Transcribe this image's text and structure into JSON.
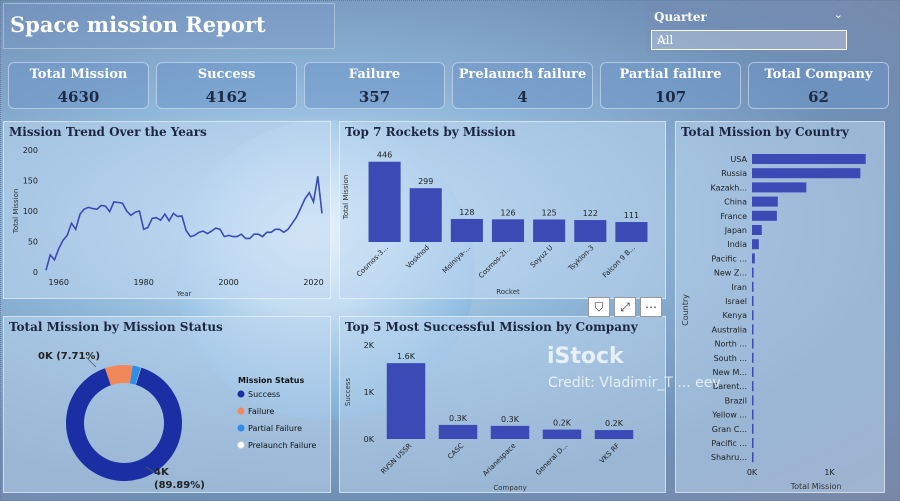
{
  "title": "Space mission Report",
  "slicer": {
    "label": "Quarter",
    "value": "All"
  },
  "kpis": [
    {
      "label": "Total Mission",
      "value": "4630"
    },
    {
      "label": "Success",
      "value": "4162"
    },
    {
      "label": "Failure",
      "value": "357"
    },
    {
      "label": "Prelaunch failure",
      "value": "4"
    },
    {
      "label": "Partial failure",
      "value": "107"
    },
    {
      "label": "Total Company",
      "value": "62"
    }
  ],
  "trend": {
    "title": "Mission Trend Over the Years",
    "xlabel": "Year",
    "ylabel": "Total Mission",
    "yticks": [
      "200",
      "150",
      "100",
      "50",
      "0"
    ],
    "xticks": [
      "1960",
      "1980",
      "2000",
      "2020"
    ]
  },
  "rockets": {
    "title": "Top 7 Rockets by Mission",
    "xlabel": "Rocket",
    "ylabel": "Total Mission"
  },
  "country": {
    "title": "Total Mission by Country",
    "xlabel": "Total Mission",
    "ylabel": "Country",
    "xticks": [
      "0K",
      "1K"
    ]
  },
  "status": {
    "title": "Total Mission by Mission Status",
    "legend_title": "Mission Status",
    "label_small": "0K (7.71%)",
    "label_big_1": "4K",
    "label_big_2": "(89.89%)"
  },
  "company": {
    "title": "Top 5 Most Successful Mission by Company",
    "xlabel": "Company",
    "ylabel": "Success",
    "yticks": [
      "2K",
      "1K",
      "0K"
    ]
  },
  "watermark": {
    "line1": "iStock",
    "line2": "Credit: Vladimir_T ... eev"
  },
  "colors": {
    "bar": "#3a4bb6",
    "line": "#3a4bb6",
    "success": "#1a2fa3",
    "failure": "#f0885a",
    "partial": "#2f8fe8",
    "prelaunch": "#ffffff"
  },
  "chart_data": [
    {
      "type": "line",
      "title": "Mission Trend Over the Years",
      "xlabel": "Year",
      "ylabel": "Total Mission",
      "xlim": [
        1957,
        2022
      ],
      "ylim": [
        0,
        200
      ],
      "x": [
        1957,
        1958,
        1959,
        1960,
        1961,
        1962,
        1963,
        1964,
        1965,
        1966,
        1967,
        1968,
        1969,
        1970,
        1971,
        1972,
        1973,
        1974,
        1975,
        1976,
        1977,
        1978,
        1979,
        1980,
        1981,
        1982,
        1983,
        1984,
        1985,
        1986,
        1987,
        1988,
        1989,
        1990,
        1991,
        1992,
        1993,
        1994,
        1995,
        1996,
        1997,
        1998,
        1999,
        2000,
        2001,
        2002,
        2003,
        2004,
        2005,
        2006,
        2007,
        2008,
        2009,
        2010,
        2011,
        2012,
        2013,
        2014,
        2015,
        2016,
        2017,
        2018,
        2019,
        2020,
        2021,
        2022
      ],
      "y": [
        3,
        28,
        20,
        38,
        52,
        60,
        80,
        70,
        95,
        103,
        106,
        104,
        103,
        109,
        108,
        99,
        115,
        114,
        113,
        100,
        93,
        98,
        100,
        70,
        73,
        88,
        89,
        85,
        95,
        84,
        96,
        91,
        92,
        68,
        58,
        60,
        65,
        67,
        63,
        67,
        72,
        70,
        58,
        60,
        58,
        58,
        62,
        55,
        55,
        62,
        62,
        58,
        65,
        65,
        70,
        70,
        65,
        70,
        80,
        90,
        105,
        120,
        130,
        115,
        157,
        96
      ]
    },
    {
      "type": "bar",
      "title": "Top 7 Rockets by Mission",
      "xlabel": "Rocket",
      "ylabel": "Total Mission",
      "categories": [
        "Cosmos-3...",
        "Voskhod",
        "Molniya-...",
        "Cosmos-2I...",
        "Soyuz U",
        "Tsyklon-3",
        "Falcon 9 B..."
      ],
      "values": [
        446,
        299,
        128,
        126,
        125,
        122,
        111
      ],
      "data_labels": [
        "446",
        "299",
        "128",
        "126",
        "125",
        "122",
        "111"
      ]
    },
    {
      "type": "bar",
      "title": "Total Mission by Country",
      "xlabel": "Total Mission",
      "ylabel": "Country",
      "categories": [
        "USA",
        "Russia",
        "Kazakh...",
        "China",
        "France",
        "Japan",
        "India",
        "Pacific ...",
        "New Z...",
        "Iran",
        "Israel",
        "Kenya",
        "Australia",
        "North ...",
        "South ...",
        "New M...",
        "Barent...",
        "Brazil",
        "Yellow ...",
        "Gran C...",
        "Pacific ...",
        "Shahru..."
      ],
      "values": [
        1467,
        1398,
        701,
        333,
        321,
        126,
        88,
        36,
        20,
        14,
        11,
        9,
        6,
        5,
        4,
        4,
        3,
        3,
        3,
        2,
        1,
        1
      ]
    },
    {
      "type": "pie",
      "title": "Total Mission by Mission Status",
      "categories": [
        "Success",
        "Failure",
        "Partial Failure",
        "Prelaunch Failure"
      ],
      "values": [
        4162,
        357,
        107,
        4
      ],
      "data_labels": [
        "4K (89.89%)",
        "0K (7.71%)"
      ]
    },
    {
      "type": "bar",
      "title": "Top 5 Most Successful Mission by Company",
      "xlabel": "Company",
      "ylabel": "Success",
      "ylim": [
        0,
        2000
      ],
      "categories": [
        "RVSN USSR",
        "CASC",
        "Arianespace",
        "General D...",
        "VKS RF"
      ],
      "values": [
        1614,
        300,
        280,
        200,
        190
      ],
      "data_labels": [
        "1.6K",
        "0.3K",
        "0.3K",
        "0.2K",
        "0.2K"
      ]
    }
  ]
}
